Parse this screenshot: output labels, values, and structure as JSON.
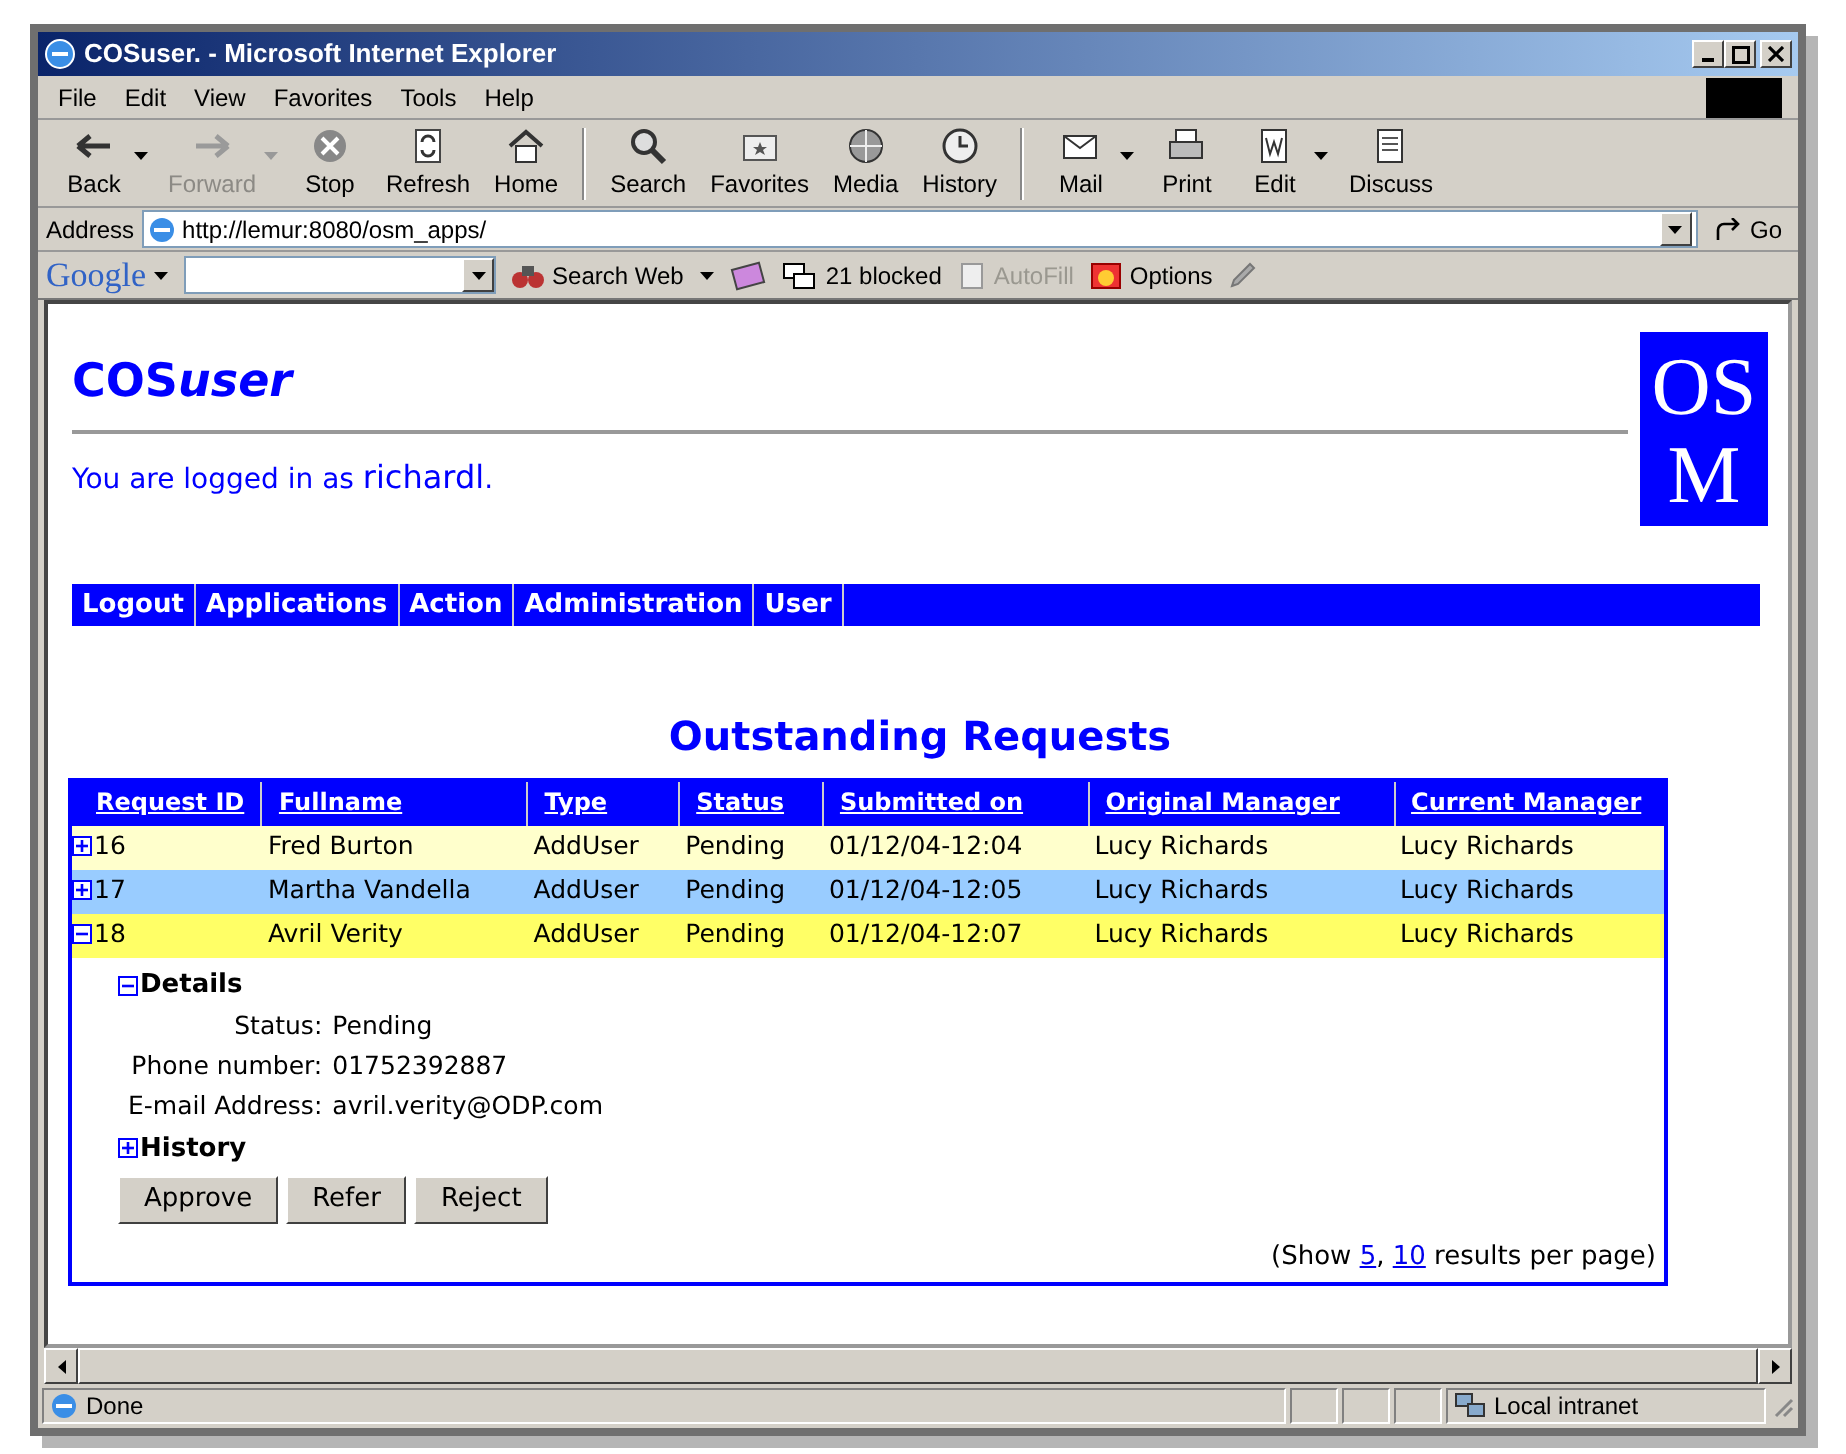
{
  "window": {
    "title": "COSuser. - Microsoft Internet Explorer"
  },
  "menu": [
    "File",
    "Edit",
    "View",
    "Favorites",
    "Tools",
    "Help"
  ],
  "toolbar_groups": [
    {
      "buttons": [
        {
          "label": "Back",
          "disabled": false,
          "dropdown": true
        },
        {
          "label": "Forward",
          "disabled": true,
          "dropdown": true
        },
        {
          "label": "Stop",
          "disabled": false,
          "dropdown": false
        },
        {
          "label": "Refresh",
          "disabled": false,
          "dropdown": false
        },
        {
          "label": "Home",
          "disabled": false,
          "dropdown": false
        }
      ]
    },
    {
      "buttons": [
        {
          "label": "Search",
          "disabled": false,
          "dropdown": false
        },
        {
          "label": "Favorites",
          "disabled": false,
          "dropdown": false
        },
        {
          "label": "Media",
          "disabled": false,
          "dropdown": false
        },
        {
          "label": "History",
          "disabled": false,
          "dropdown": false
        }
      ]
    },
    {
      "buttons": [
        {
          "label": "Mail",
          "disabled": false,
          "dropdown": true
        },
        {
          "label": "Print",
          "disabled": false,
          "dropdown": false
        },
        {
          "label": "Edit",
          "disabled": false,
          "dropdown": true
        },
        {
          "label": "Discuss",
          "disabled": false,
          "dropdown": false
        }
      ]
    }
  ],
  "address": {
    "label": "Address",
    "url": "http://lemur:8080/osm_apps/",
    "go": "Go"
  },
  "google_bar": {
    "logo": "Google",
    "search_web": "Search Web",
    "blocked": "21 blocked",
    "autofill": {
      "label": "AutoFill",
      "disabled": true
    },
    "options": "Options"
  },
  "page": {
    "title_parts": [
      {
        "text": "COS",
        "italic": false
      },
      {
        "text": "user",
        "italic": true
      }
    ],
    "login_text": "You are logged in as **richardl**.",
    "logo_lines": [
      "OS",
      "M"
    ],
    "nav": [
      "Logout",
      "Applications",
      "Action",
      "Administration",
      "User"
    ],
    "heading": "Outstanding Requests",
    "table": {
      "columns": [
        "Request ID",
        "Fullname",
        "Type",
        "Status",
        "Submitted on",
        "Original Manager",
        "Current Manager"
      ],
      "rows": [
        {
          "color": "#ffffcc",
          "expanded": false,
          "cells": [
            "16",
            "Fred Burton",
            "AddUser",
            "Pending",
            "01/12/04-12:04",
            "Lucy Richards",
            "Lucy Richards"
          ]
        },
        {
          "color": "#99ccff",
          "expanded": false,
          "cells": [
            "17",
            "Martha Vandella",
            "AddUser",
            "Pending",
            "01/12/04-12:05",
            "Lucy Richards",
            "Lucy Richards"
          ]
        },
        {
          "color": "#ffff66",
          "expanded": true,
          "cells": [
            "18",
            "Avril Verity",
            "AddUser",
            "Pending",
            "01/12/04-12:07",
            "Lucy Richards",
            "Lucy Richards"
          ],
          "details": {
            "sections": [
              {
                "title": "Details",
                "expanded": true,
                "fields": [
                  {
                    "label": "Status:",
                    "value": "Pending"
                  },
                  {
                    "label": "Phone number:",
                    "value": "01752392887"
                  },
                  {
                    "label": "E-mail Address:",
                    "value": "avril.verity@ODP.com"
                  }
                ]
              },
              {
                "title": "History",
                "expanded": false
              }
            ],
            "buttons": [
              "Approve",
              "Refer",
              "Reject"
            ]
          }
        }
      ]
    },
    "pagination": {
      "prefix": "(Show",
      "links": [
        "5",
        "10"
      ],
      "separator": ",",
      "suffix": "results per page)"
    }
  },
  "status_bar": {
    "text": "Done",
    "zone": "Local intranet"
  }
}
